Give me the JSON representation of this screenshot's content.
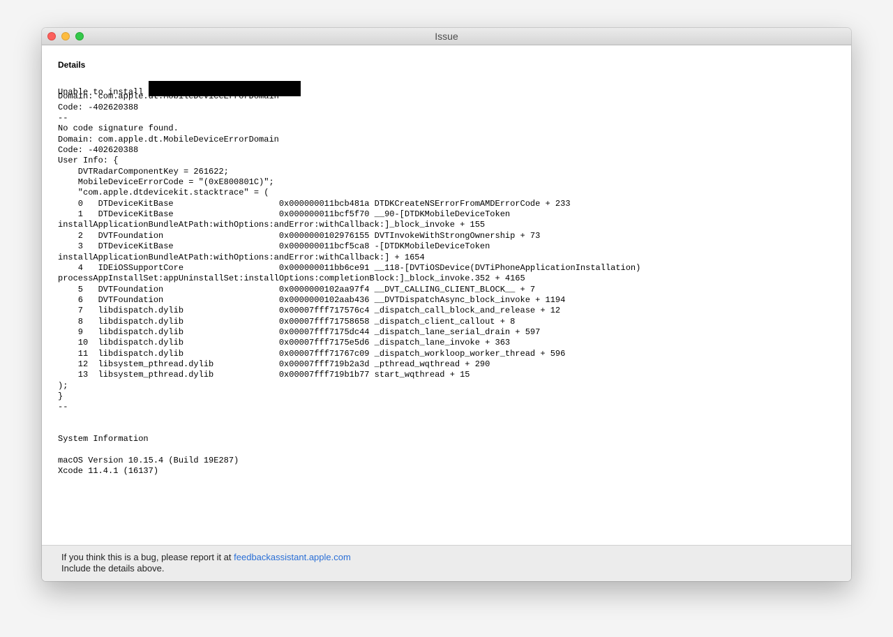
{
  "window": {
    "title": "Issue"
  },
  "details": {
    "heading": "Details",
    "lines": [
      "Unable to install ",
      "Domain: com.apple.dt.MobileDeviceErrorDomain",
      "Code: -402620388",
      "--",
      "No code signature found.",
      "Domain: com.apple.dt.MobileDeviceErrorDomain",
      "Code: -402620388",
      "User Info: {",
      "    DVTRadarComponentKey = 261622;",
      "    MobileDeviceErrorCode = \"(0xE800801C)\";",
      "    \"com.apple.dtdevicekit.stacktrace\" = (",
      "    0   DTDeviceKitBase                     0x000000011bcb481a DTDKCreateNSErrorFromAMDErrorCode + 233",
      "    1   DTDeviceKitBase                     0x000000011bcf5f70 __90-[DTDKMobileDeviceToken",
      "installApplicationBundleAtPath:withOptions:andError:withCallback:]_block_invoke + 155",
      "    2   DVTFoundation                       0x0000000102976155 DVTInvokeWithStrongOwnership + 73",
      "    3   DTDeviceKitBase                     0x000000011bcf5ca8 -[DTDKMobileDeviceToken",
      "installApplicationBundleAtPath:withOptions:andError:withCallback:] + 1654",
      "    4   IDEiOSSupportCore                   0x000000011bb6ce91 __118-[DVTiOSDevice(DVTiPhoneApplicationInstallation)",
      "processAppInstallSet:appUninstallSet:installOptions:completionBlock:]_block_invoke.352 + 4165",
      "    5   DVTFoundation                       0x0000000102aa97f4 __DVT_CALLING_CLIENT_BLOCK__ + 7",
      "    6   DVTFoundation                       0x0000000102aab436 __DVTDispatchAsync_block_invoke + 1194",
      "    7   libdispatch.dylib                   0x00007fff717576c4 _dispatch_call_block_and_release + 12",
      "    8   libdispatch.dylib                   0x00007fff71758658 _dispatch_client_callout + 8",
      "    9   libdispatch.dylib                   0x00007fff7175dc44 _dispatch_lane_serial_drain + 597",
      "    10  libdispatch.dylib                   0x00007fff7175e5d6 _dispatch_lane_invoke + 363",
      "    11  libdispatch.dylib                   0x00007fff71767c09 _dispatch_workloop_worker_thread + 596",
      "    12  libsystem_pthread.dylib             0x00007fff719b2a3d _pthread_wqthread + 290",
      "    13  libsystem_pthread.dylib             0x00007fff719b1b77 start_wqthread + 15",
      ");",
      "}",
      "--"
    ]
  },
  "system": {
    "heading": "System Information",
    "lines": [
      "macOS Version 10.15.4 (Build 19E287)",
      "Xcode 11.4.1 (16137)"
    ]
  },
  "footer": {
    "text_before_link": "If you think this is a bug, please report it at ",
    "link": "feedbackassistant.apple.com",
    "line2": "Include the details above."
  },
  "colors": {
    "link": "#2a6fd6",
    "close": "#fc605c",
    "minimize": "#fdbc40",
    "maximize": "#34c84a"
  }
}
